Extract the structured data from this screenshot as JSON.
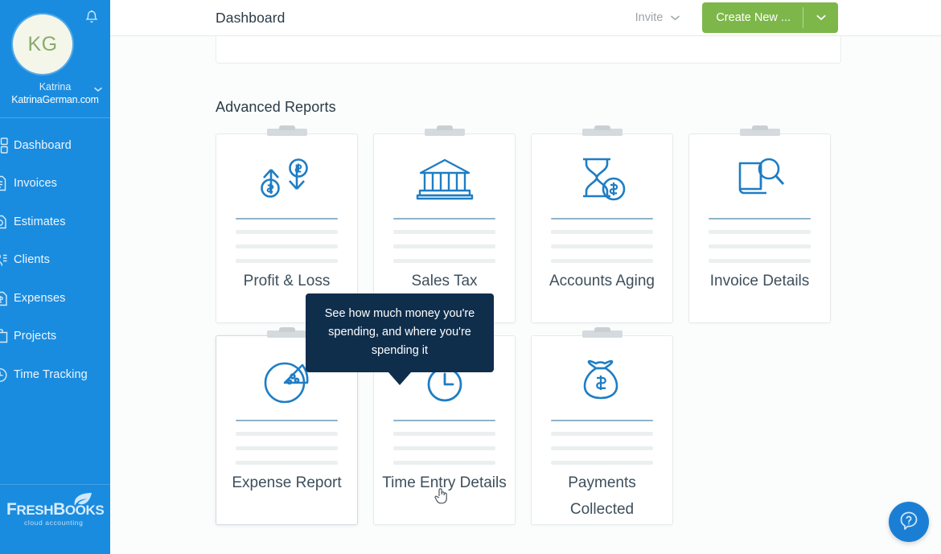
{
  "sidebar": {
    "avatar_initials": "KG",
    "user_name": "Katrina",
    "user_email": "KatrinaGerman.com",
    "bell_icon": "notification-bell-icon",
    "caret_icon": "chevron-down-icon",
    "items": [
      {
        "label": "Dashboard",
        "icon": "dashboard-icon"
      },
      {
        "label": "Invoices",
        "icon": "invoice-icon"
      },
      {
        "label": "Estimates",
        "icon": "estimate-icon"
      },
      {
        "label": "Clients",
        "icon": "clients-icon"
      },
      {
        "label": "Expenses",
        "icon": "expenses-icon"
      },
      {
        "label": "Projects",
        "icon": "projects-icon"
      },
      {
        "label": "Time Tracking",
        "icon": "time-tracking-icon"
      }
    ],
    "brand_name_1": "F",
    "brand_name_2": "RESH",
    "brand_name_3": "B",
    "brand_name_4": "OOKS",
    "brand_tagline": "cloud accounting"
  },
  "header": {
    "title": "Dashboard",
    "invite_label": "Invite",
    "invite_caret_icon": "chevron-down-icon",
    "create_label": "Create New ...",
    "create_caret_icon": "chevron-down-icon",
    "create_button_color": "#7db74a"
  },
  "main": {
    "section_title": "Advanced Reports",
    "cards": [
      {
        "title": "Profit & Loss",
        "icon": "profit-loss-arrows-icon"
      },
      {
        "title": "Sales Tax Summary",
        "icon": "bank-building-icon"
      },
      {
        "title": "Accounts Aging",
        "icon": "hourglass-dollar-icon"
      },
      {
        "title": "Invoice Details",
        "icon": "document-magnifier-icon"
      },
      {
        "title": "Expense Report",
        "icon": "pie-chart-icon"
      },
      {
        "title": "Time Entry Details",
        "icon": "stopwatch-icon"
      },
      {
        "title": "Payments Collected",
        "icon": "money-bag-icon"
      }
    ]
  },
  "tooltip": {
    "text": "See how much money you're spending, and where you're spending it",
    "background": "#0f2e4c"
  },
  "help": {
    "icon": "question-mark-help-icon",
    "color": "#1a7fd4"
  },
  "cursor": {
    "icon": "pointing-hand-cursor-icon"
  }
}
